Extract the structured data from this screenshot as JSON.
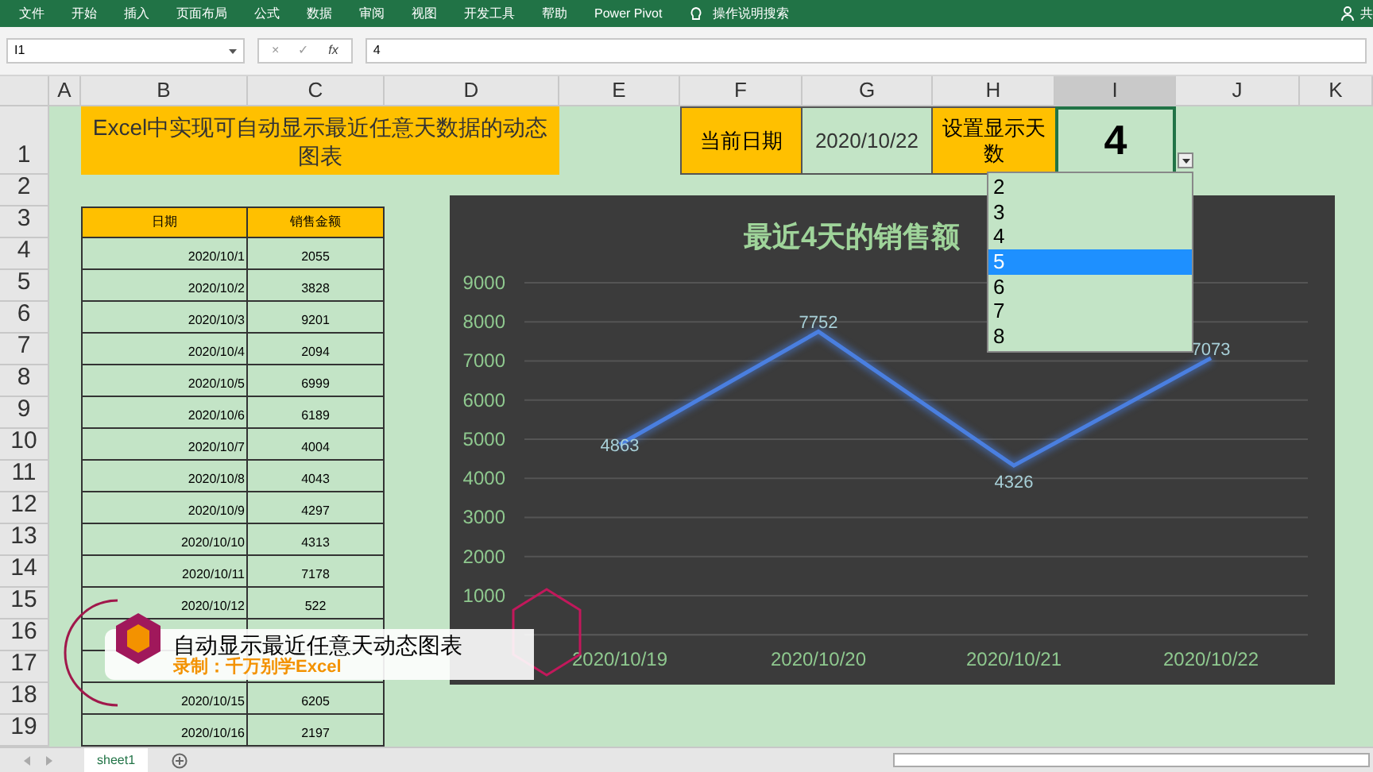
{
  "ribbon": {
    "tabs": [
      "文件",
      "开始",
      "插入",
      "页面布局",
      "公式",
      "数据",
      "审阅",
      "视图",
      "开发工具",
      "帮助",
      "Power Pivot"
    ],
    "search": "操作说明搜索",
    "share": "共"
  },
  "formula_bar": {
    "name_box": "I1",
    "cancel": "×",
    "enter": "✓",
    "fx": "fx",
    "value": "4"
  },
  "columns": [
    {
      "label": "A",
      "selected": false
    },
    {
      "label": "B",
      "selected": false
    },
    {
      "label": "C",
      "selected": false
    },
    {
      "label": "D",
      "selected": false
    },
    {
      "label": "E",
      "selected": false
    },
    {
      "label": "F",
      "selected": false
    },
    {
      "label": "G",
      "selected": false
    },
    {
      "label": "H",
      "selected": false
    },
    {
      "label": "I",
      "selected": true
    },
    {
      "label": "J",
      "selected": false
    },
    {
      "label": "K",
      "selected": false
    }
  ],
  "rows": [
    "1",
    "2",
    "3",
    "4",
    "5",
    "6",
    "7",
    "8",
    "9",
    "10",
    "11",
    "12",
    "13",
    "14",
    "15",
    "16",
    "17",
    "18",
    "19"
  ],
  "title": "Excel中实现可自动显示最近任意天数据的动态图表",
  "current_date_label": "当前日期",
  "current_date": "2020/10/22",
  "days_label": "设置显示天数",
  "days_value": "4",
  "table": {
    "columns": [
      "日期",
      "销售金额"
    ],
    "rows": [
      {
        "date": "2020/10/1",
        "amount": "2055"
      },
      {
        "date": "2020/10/2",
        "amount": "3828"
      },
      {
        "date": "2020/10/3",
        "amount": "9201"
      },
      {
        "date": "2020/10/4",
        "amount": "2094"
      },
      {
        "date": "2020/10/5",
        "amount": "6999"
      },
      {
        "date": "2020/10/6",
        "amount": "6189"
      },
      {
        "date": "2020/10/7",
        "amount": "4004"
      },
      {
        "date": "2020/10/8",
        "amount": "4043"
      },
      {
        "date": "2020/10/9",
        "amount": "4297"
      },
      {
        "date": "2020/10/10",
        "amount": "4313"
      },
      {
        "date": "2020/10/11",
        "amount": "7178"
      },
      {
        "date": "2020/10/12",
        "amount": "522"
      },
      {
        "date": "2020/10/15",
        "amount": "6205"
      },
      {
        "date": "2020/10/16",
        "amount": "2197"
      }
    ]
  },
  "chart": {
    "chart_data": {
      "type": "line",
      "title": "最近4天的销售额",
      "categories": [
        "2020/10/19",
        "2020/10/20",
        "2020/10/21",
        "2020/10/22"
      ],
      "series": [
        {
          "color": "#4a7fe0",
          "values": [
            4863,
            7752,
            4326,
            7073
          ]
        }
      ],
      "ylim": [
        0,
        9000
      ],
      "yticks": [
        1000,
        2000,
        3000,
        4000,
        5000,
        6000,
        7000,
        8000,
        9000
      ],
      "grid": true,
      "data_labels": true
    }
  },
  "dropdown": {
    "options": [
      {
        "label": "2",
        "selected": false
      },
      {
        "label": "3",
        "selected": false
      },
      {
        "label": "4",
        "selected": false
      },
      {
        "label": "5",
        "selected": true
      },
      {
        "label": "6",
        "selected": false
      },
      {
        "label": "7",
        "selected": false
      },
      {
        "label": "8",
        "selected": false
      }
    ]
  },
  "caption": {
    "title": "自动显示最近任意天动态图表",
    "subtitle": "录制：千万别学Excel"
  },
  "sheet_tabs": [
    {
      "label": "sheet1",
      "selected": true
    }
  ]
}
